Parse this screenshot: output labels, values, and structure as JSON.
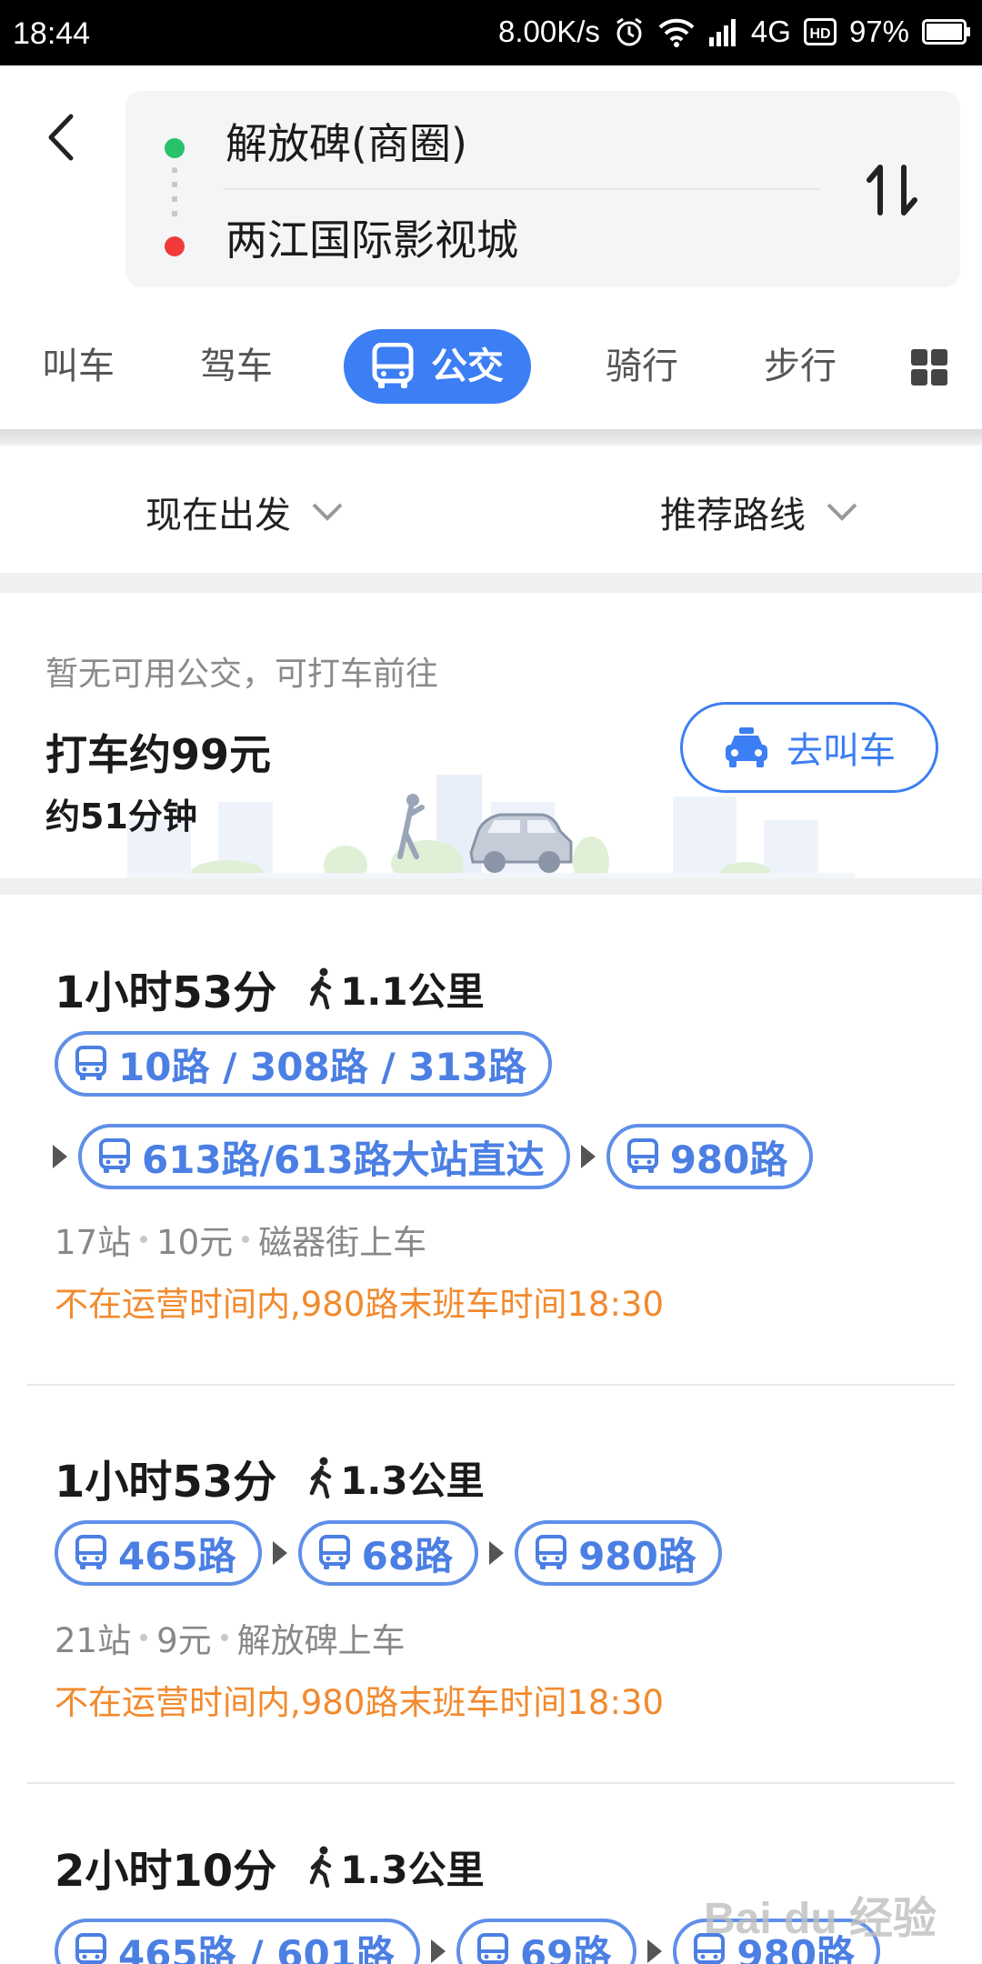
{
  "status_bar": {
    "time": "18:44",
    "net_speed": "8.00K/s",
    "network": "4G",
    "battery": "97%"
  },
  "search": {
    "from": "解放碑(商圈)",
    "to": "两江国际影视城"
  },
  "tabs": [
    {
      "label": "叫车"
    },
    {
      "label": "驾车"
    },
    {
      "label": "公交",
      "active": true
    },
    {
      "label": "骑行"
    },
    {
      "label": "步行"
    }
  ],
  "filters": {
    "depart": "现在出发",
    "sort": "推荐路线"
  },
  "taxi": {
    "note": "暂无可用公交，可打车前往",
    "price": "打车约99元",
    "duration": "约51分钟",
    "button": "去叫车"
  },
  "routes": [
    {
      "duration": "1小时53分",
      "walk": "1.1公里",
      "rows": [
        [
          "10路 / 308路 / 313路"
        ],
        [
          "613路/613路大站直达",
          "980路"
        ]
      ],
      "stops": "17站",
      "fare": "10元",
      "board": "磁器街上车",
      "warning": "不在运营时间内,980路末班车时间18:30"
    },
    {
      "duration": "1小时53分",
      "walk": "1.3公里",
      "rows": [
        [
          "465路",
          "68路",
          "980路"
        ]
      ],
      "stops": "21站",
      "fare": "9元",
      "board": "解放碑上车",
      "warning": "不在运营时间内,980路末班车时间18:30"
    },
    {
      "duration": "2小时10分",
      "walk": "1.3公里",
      "rows": [
        [
          "465路 / 601路",
          "69路",
          "980路"
        ]
      ]
    }
  ],
  "watermark": "Bai du 经验",
  "colors": {
    "accent": "#3c7ef3",
    "warning": "#f28a2e",
    "start_dot": "#27c26a",
    "end_dot": "#f23a3a"
  }
}
